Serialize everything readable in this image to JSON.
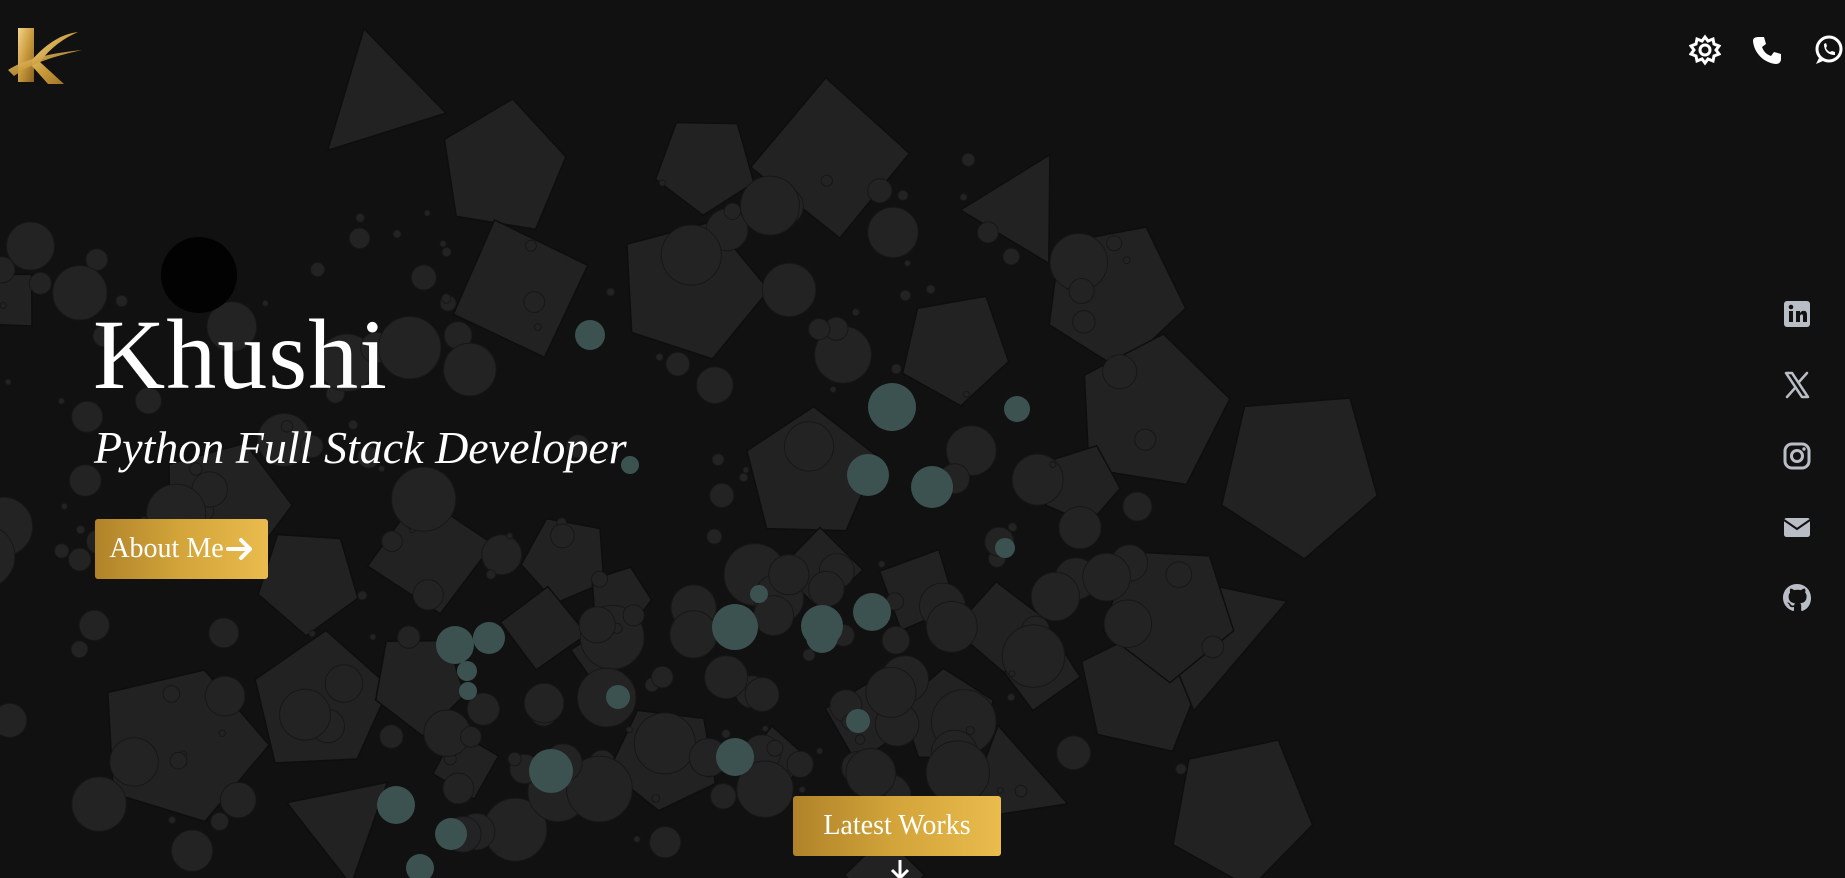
{
  "brand": {
    "logo_letter": "K"
  },
  "top_bar": {
    "icons": [
      "gear-icon",
      "phone-icon",
      "whatsapp-icon"
    ]
  },
  "hero": {
    "name": "Khushi",
    "role": "Python Full Stack Developer",
    "about_button": "About Me"
  },
  "latest_works_button": "Latest Works",
  "social": [
    "linkedin-icon",
    "x-twitter-icon",
    "instagram-icon",
    "mail-icon",
    "github-icon"
  ],
  "colors": {
    "background": "#111111",
    "polygon_fill": "#222222",
    "dot": "#232323",
    "teal_dot": "#3b5250",
    "gold_start": "#b0832a",
    "gold_end": "#eabb4d",
    "icon_muted": "#b9bdc6"
  }
}
